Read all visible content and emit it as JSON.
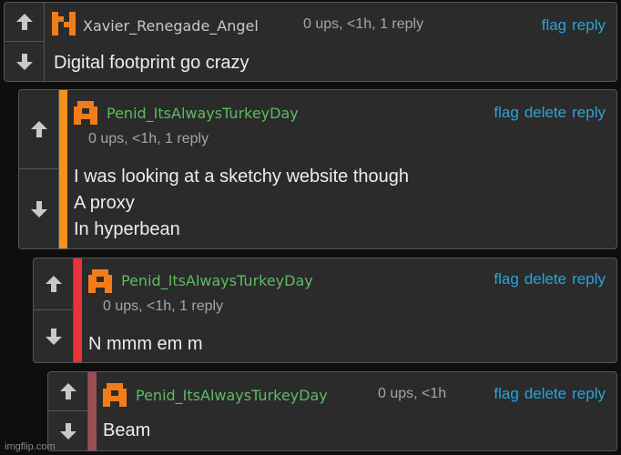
{
  "comments": [
    {
      "username": "Xavier_Renegade_Angel",
      "meta": "0 ups, <1h, 1 reply",
      "actions": [
        "flag",
        "reply"
      ],
      "body": [
        "Digital footprint go crazy"
      ],
      "avatar_color": "#f07d1a"
    },
    {
      "username": "Penid_ItsAlwaysTurkeyDay",
      "meta": "0 ups, <1h, 1 reply",
      "actions": [
        "flag",
        "delete",
        "reply"
      ],
      "body": [
        "I was looking at a sketchy website though",
        "A proxy",
        "In hyperbean"
      ],
      "accent_color": "#f5921e",
      "avatar_color": "#f07d1a"
    },
    {
      "username": "Penid_ItsAlwaysTurkeyDay",
      "meta": "0 ups, <1h, 1 reply",
      "actions": [
        "flag",
        "delete",
        "reply"
      ],
      "body": [
        "N mmm em m"
      ],
      "accent_color": "#e8333a",
      "avatar_color": "#f07d1a"
    },
    {
      "username": "Penid_ItsAlwaysTurkeyDay",
      "meta": "0 ups, <1h",
      "actions": [
        "flag",
        "delete",
        "reply"
      ],
      "body": [
        "Beam"
      ],
      "accent_color": "#9a4e52",
      "avatar_color": "#f07d1a"
    }
  ],
  "watermark": "imgflip.com"
}
